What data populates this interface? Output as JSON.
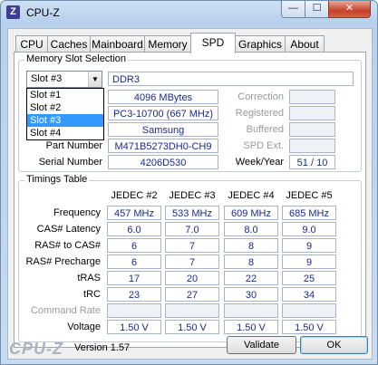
{
  "window": {
    "title": "CPU-Z",
    "icon_letter": "Z",
    "min": "—",
    "max": "☐",
    "close": "✕"
  },
  "tabs": [
    "CPU",
    "Caches",
    "Mainboard",
    "Memory",
    "SPD",
    "Graphics",
    "About"
  ],
  "active_tab": "SPD",
  "memory_slot": {
    "group_title": "Memory Slot Selection",
    "selected": "Slot #3",
    "options": [
      "Slot #1",
      "Slot #2",
      "Slot #3",
      "Slot #4"
    ],
    "type": "DDR3",
    "size": "4096 MBytes",
    "max_bandwidth": "PC3-10700 (667 MHz)",
    "manufacturer": "Samsung",
    "part_number_label": "Part Number",
    "part_number": "M471B5273DH0-CH9",
    "serial_number_label": "Serial Number",
    "serial_number": "4206D530",
    "correction_label": "Correction",
    "registered_label": "Registered",
    "buffered_label": "Buffered",
    "spd_ext_label": "SPD Ext.",
    "week_year_label": "Week/Year",
    "week_year": "51 / 10"
  },
  "timings": {
    "group_title": "Timings Table",
    "columns": [
      "JEDEC #2",
      "JEDEC #3",
      "JEDEC #4",
      "JEDEC #5"
    ],
    "rows": [
      {
        "label": "Frequency",
        "values": [
          "457 MHz",
          "533 MHz",
          "609 MHz",
          "685 MHz"
        ]
      },
      {
        "label": "CAS# Latency",
        "values": [
          "6.0",
          "7.0",
          "8.0",
          "9.0"
        ]
      },
      {
        "label": "RAS# to CAS#",
        "values": [
          "6",
          "7",
          "8",
          "9"
        ]
      },
      {
        "label": "RAS# Precharge",
        "values": [
          "6",
          "7",
          "8",
          "9"
        ]
      },
      {
        "label": "tRAS",
        "values": [
          "17",
          "20",
          "22",
          "25"
        ]
      },
      {
        "label": "tRC",
        "values": [
          "23",
          "27",
          "30",
          "34"
        ]
      },
      {
        "label": "Command Rate",
        "values": [
          "",
          "",
          "",
          ""
        ],
        "dim": true
      },
      {
        "label": "Voltage",
        "values": [
          "1.50 V",
          "1.50 V",
          "1.50 V",
          "1.50 V"
        ]
      }
    ]
  },
  "footer": {
    "logo": "CPU-Z",
    "version": "Version 1.57",
    "validate": "Validate",
    "ok": "OK"
  }
}
